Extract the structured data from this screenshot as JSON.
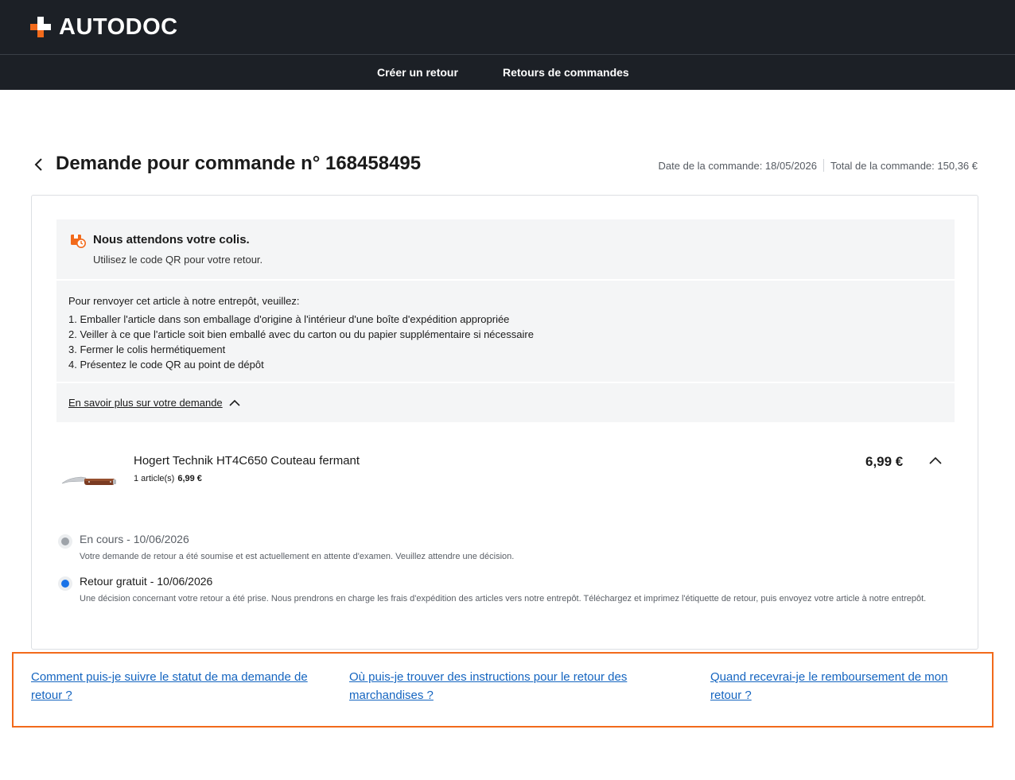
{
  "header": {
    "brand": "AUTODOC",
    "brand_color": "#f26a1b",
    "nav": [
      {
        "label": "Créer un retour"
      },
      {
        "label": "Retours de commandes"
      }
    ]
  },
  "page": {
    "title": "Demande pour commande n° 168458495",
    "order_date": "Date de la commande: 18/05/2026",
    "order_total": "Total de la commande: 150,36 €"
  },
  "status": {
    "icon": "parcel-clock-icon",
    "title": "Nous attendons votre colis.",
    "subtitle": "Utilisez le code QR pour votre retour."
  },
  "instructions": {
    "title": "Pour renvoyer cet article à notre entrepôt, veuillez:",
    "items": [
      "1. Emballer l'article dans son emballage d'origine à l'intérieur d'une boîte d'expédition appropriée",
      "2. Veiller à ce que l'article soit bien emballé avec du carton ou du papier supplémentaire si nécessaire",
      "3. Fermer le colis hermétiquement",
      "4. Présentez le code QR au point de dépôt"
    ]
  },
  "more_link": "En savoir plus sur votre demande",
  "product": {
    "name": "Hogert Technik HT4C650 Couteau fermant",
    "quantity": "1 article(s)",
    "unit_price": "6,99 €",
    "price": "6,99 €"
  },
  "timeline": [
    {
      "title": "En cours - 10/06/2026",
      "description": "Votre demande de retour a été soumise et est actuellement en attente d'examen. Veuillez attendre une décision.",
      "color": "#9ea3a9"
    },
    {
      "title": "Retour gratuit - 10/06/2026",
      "description": "Une décision concernant votre retour a été prise. Nous prendrons en charge les frais d'expédition des articles vers notre entrepôt. Téléchargez et imprimez l'étiquette de retour, puis envoyez votre article à notre entrepôt.",
      "color": "#1a73e8"
    }
  ],
  "faq": [
    {
      "label": "Comment puis-je suivre le statut de ma demande de retour ?"
    },
    {
      "label": "Où puis-je trouver des instructions pour le retour des marchandises ?"
    },
    {
      "label": "Quand recevrai-je le remboursement de mon retour ?"
    }
  ]
}
